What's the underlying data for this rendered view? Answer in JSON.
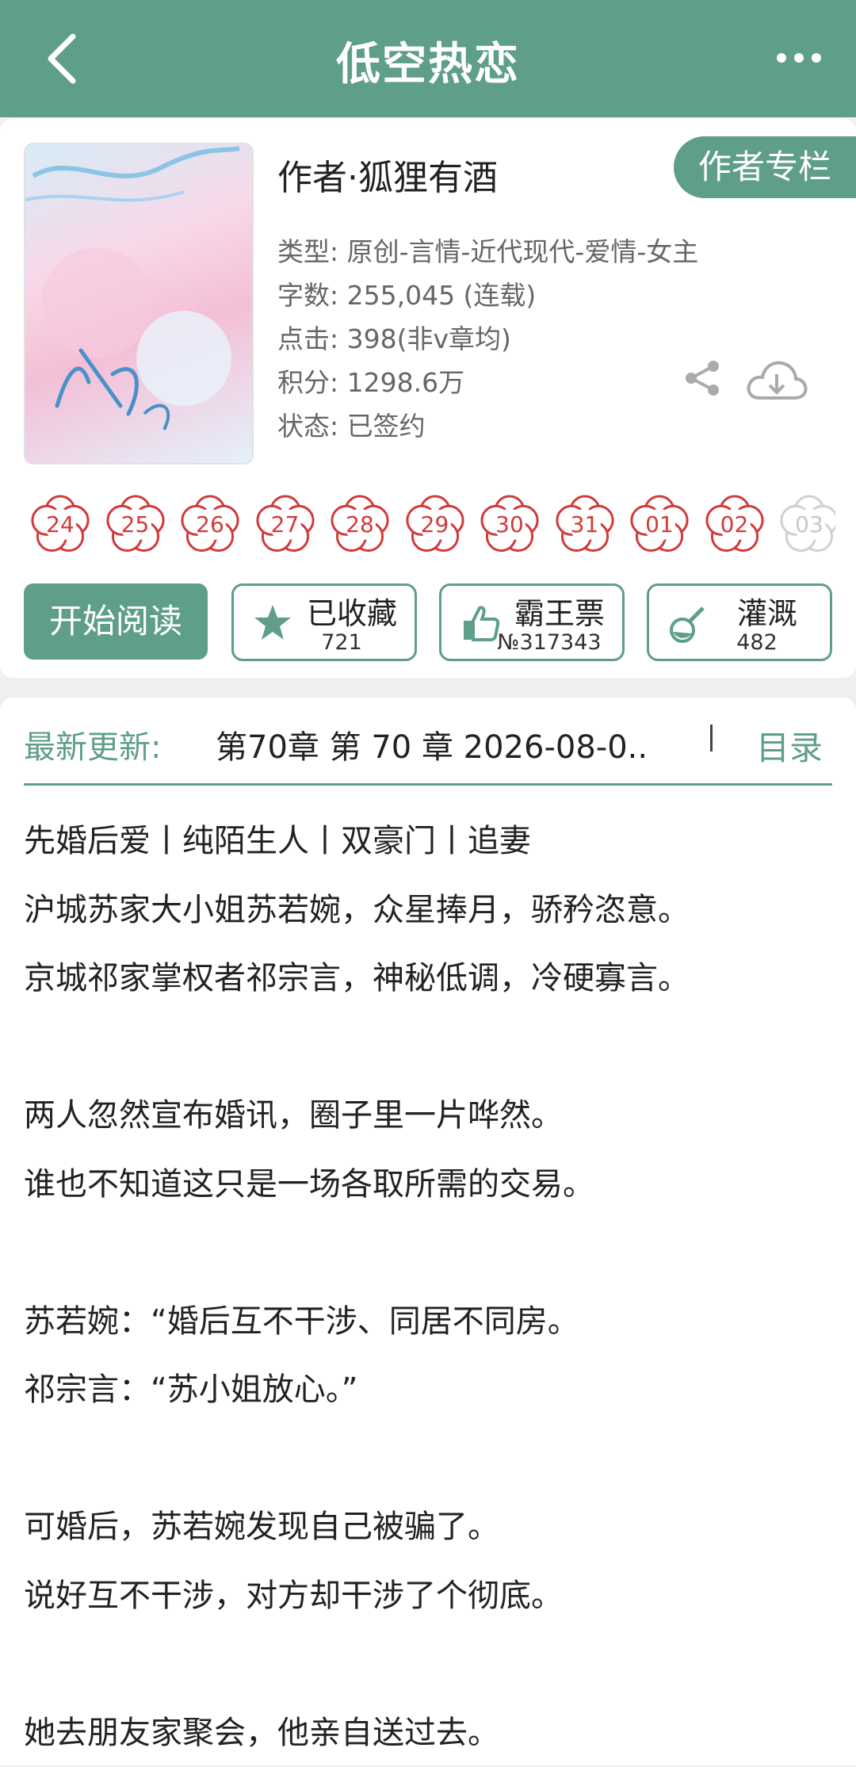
{
  "header": {
    "title": "低空热恋"
  },
  "book": {
    "author_tag": "作者专栏",
    "author": "作者·狐狸有酒",
    "meta": [
      "类型: 原创-言情-近代现代-爱情-女主",
      "字数: 255,045 (连载)",
      "点击: 398(非v章均)",
      "积分: 1298.6万",
      "状态: 已签约"
    ]
  },
  "calendar": [
    "24",
    "25",
    "26",
    "27",
    "28",
    "29",
    "30",
    "31",
    "01",
    "02",
    "03"
  ],
  "actions": {
    "read": "开始阅读",
    "collect": {
      "label": "已收藏",
      "count": "721"
    },
    "ticket": {
      "label": "霸王票",
      "count": "№317343"
    },
    "water": {
      "label": "灌溉",
      "count": "482"
    }
  },
  "update": {
    "label": "最新更新:",
    "chapter": "第70章  第 70 章  2026-08-0..",
    "toc": "目录"
  },
  "description": [
    "先婚后爱丨纯陌生人丨双豪门丨追妻",
    "沪城苏家大小姐苏若婉，众星捧月，骄矜恣意。",
    "京城祁家掌权者祁宗言，神秘低调，冷硬寡言。",
    "",
    "两人忽然宣布婚讯，圈子里一片哗然。",
    "谁也不知道这只是一场各取所需的交易。",
    "",
    "苏若婉：“婚后互不干涉、同居不同房。",
    "祁宗言：“苏小姐放心。”",
    "",
    "可婚后，苏若婉发现自己被骗了。",
    "说好互不干涉，对方却干涉了个彻底。",
    "",
    "她去朋友家聚会，他亲自送过去。"
  ],
  "colors": {
    "accent": "#5e9e8b",
    "flower": "#d23a3a"
  }
}
